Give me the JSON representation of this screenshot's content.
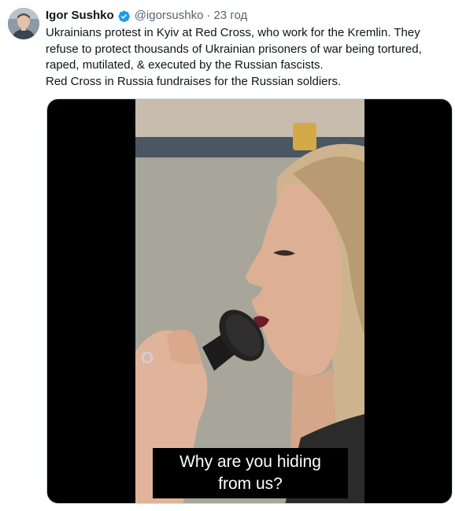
{
  "tweet": {
    "author_name": "Igor Sushko",
    "handle": "@igorsushko",
    "separator": "·",
    "time": "23 год",
    "verified_icon": "verified-badge-icon",
    "text_lines": [
      "Ukrainians protest in Kyiv at Red Cross, who work for the Kremlin. They refuse to protect thousands of Ukrainian prisoners of war being tortured, raped, mutilated, & executed by the Russian fascists.",
      "Red Cross in Russia fundraises for the Russian soldiers."
    ],
    "video": {
      "subtitle_line1": "Why are you hiding",
      "subtitle_line2": "from us?"
    }
  },
  "colors": {
    "text_primary": "#0f1419",
    "text_secondary": "#536471",
    "verified_blue": "#1d9bf0",
    "media_border": "#cfd9de"
  }
}
